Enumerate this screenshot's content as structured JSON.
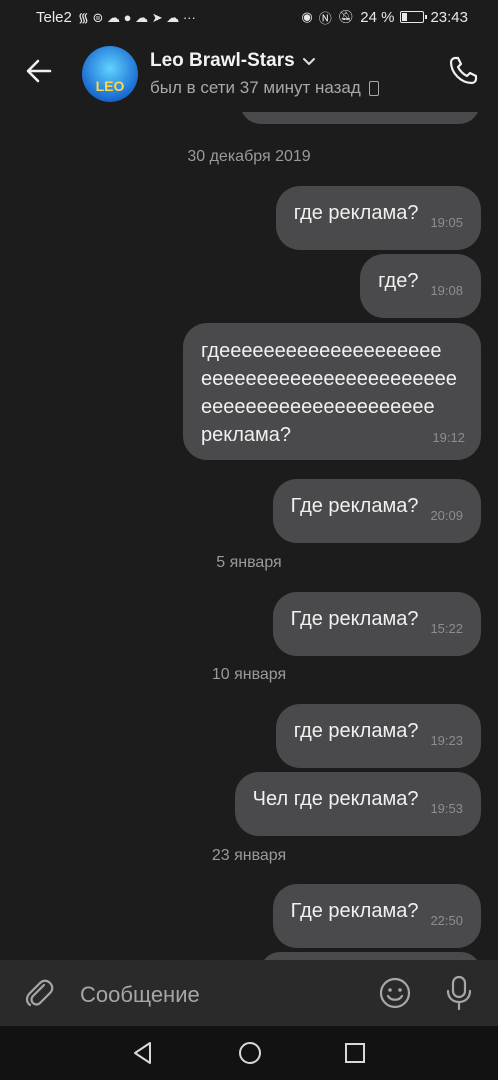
{
  "statusbar": {
    "carrier": "Tele2",
    "left_glyphs": "᯾ ⊜ ☁ ● ☁ ➤ ☁ ···",
    "battery_pct": "24 %",
    "battery_level": 0.24,
    "time": "23:43"
  },
  "header": {
    "name": "Leo Brawl-Stars",
    "status": "был в сети 37 минут назад",
    "avatar_text": "LEO"
  },
  "messages": [
    {
      "type": "date",
      "label": "30 декабря 2019"
    },
    {
      "type": "out",
      "text": "где реклама?",
      "time": "19:05"
    },
    {
      "type": "out",
      "text": "где?",
      "time": "19:08"
    },
    {
      "type": "out",
      "text": "гдееееееееееееееееееее еееееееееееееееееееееее еееееееееееееееееееее реклама?",
      "time": "19:12"
    },
    {
      "type": "out",
      "text": "Где реклама?",
      "time": "20:09"
    },
    {
      "type": "date",
      "label": "5 января"
    },
    {
      "type": "out",
      "text": "Где реклама?",
      "time": "15:22"
    },
    {
      "type": "date",
      "label": "10 января"
    },
    {
      "type": "out",
      "text": "где реклама?",
      "time": "19:23"
    },
    {
      "type": "out",
      "text": "Чел где реклама?",
      "time": "19:53"
    },
    {
      "type": "date",
      "label": "23 января"
    },
    {
      "type": "out",
      "text": "Где реклама?",
      "time": "22:50"
    }
  ],
  "long_lines": [
    "гдееееееееееееееееееее",
    "еееееееееееееееееееееее",
    "еееееееееееееееееееее",
    "реклама?"
  ],
  "composer": {
    "placeholder": "Сообщение"
  },
  "icons": {
    "back": "arrow-left-icon",
    "call": "phone-icon",
    "attach": "paperclip-icon",
    "emoji": "smiley-icon",
    "mic": "microphone-icon",
    "nav_back": "triangle-back-icon",
    "nav_home": "circle-home-icon",
    "nav_recent": "square-recent-icon"
  }
}
